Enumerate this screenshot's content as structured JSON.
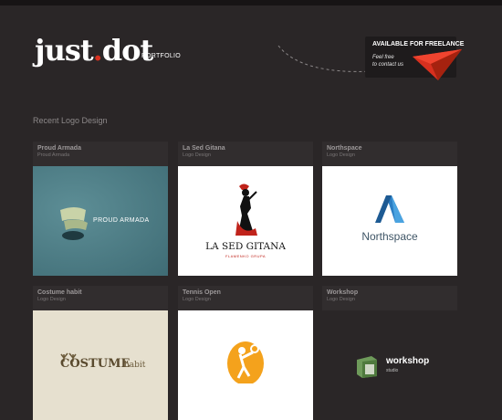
{
  "header": {
    "logo_main": "just",
    "logo_dot": ".",
    "logo_tail": "dot",
    "nav_label": "PORTFOLIO",
    "freelance_title": "AVAILABLE FOR FREELANCE",
    "freelance_line1": "Feel free",
    "freelance_line2": "to contact us"
  },
  "section": {
    "title": "Recent Logo Design"
  },
  "cards": [
    {
      "title": "Proud Armada",
      "subtitle": "Proud Armada",
      "logo_text": "PROUD ARMADA",
      "bg": "#4e7d86"
    },
    {
      "title": "La Sed Gitana",
      "subtitle": "Logo Design",
      "logo_text": "LA SED GITANA",
      "logo_sub": "FLAMENKO GRUPA",
      "bg": "#ffffff"
    },
    {
      "title": "Northspace",
      "subtitle": "Logo Design",
      "logo_text": "Northspace",
      "bg": "#ffffff"
    },
    {
      "title": "Costume habit",
      "subtitle": "Logo Design",
      "logo_text": "COSTUME",
      "logo_text2": "habit",
      "bg": "#e6e0cf"
    },
    {
      "title": "Tennis Open",
      "subtitle": "Logo Design",
      "bg": "#ffffff"
    },
    {
      "title": "Workshop",
      "subtitle": "Logo Design",
      "logo_text": "workshop",
      "logo_sub": "studio",
      "bg": "#2a2627"
    }
  ],
  "colors": {
    "background": "#2a2627",
    "accent": "#d8301f",
    "card_header": "#312d2e"
  },
  "icons": [
    "paper-plane-icon",
    "sail-ship-icon",
    "flamenco-dancer-icon",
    "north-arrow-icon",
    "antler-icon",
    "tennis-player-icon",
    "workshop-box-icon"
  ]
}
